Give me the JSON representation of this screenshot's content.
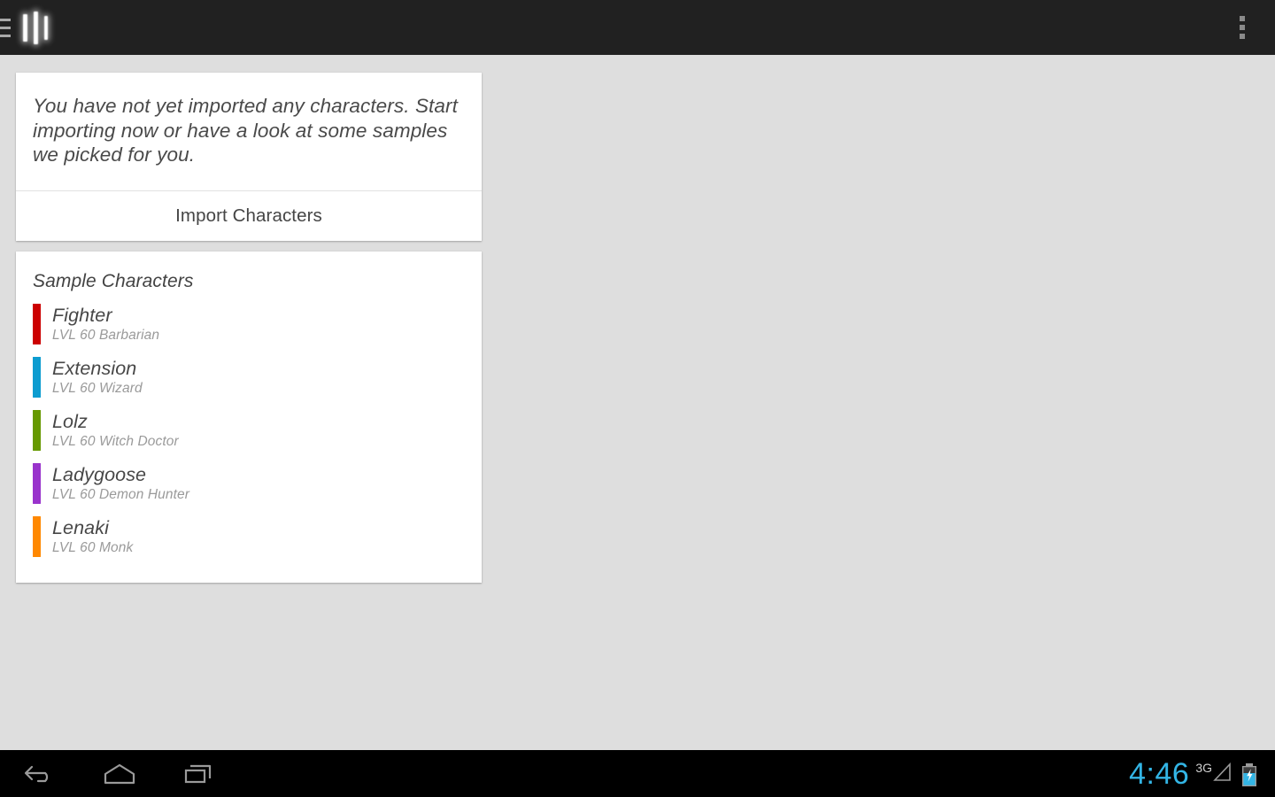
{
  "action_bar": {
    "drawer_icon": "hamburger-menu-icon",
    "logo_icon": "app-logo-three-bars",
    "overflow_icon": "overflow-menu-icon",
    "title": ""
  },
  "empty_state_card": {
    "message": "You have not yet imported any characters. Start importing now or have a look at some samples we picked for you.",
    "import_button_label": "Import Characters"
  },
  "samples_card": {
    "title": "Sample Characters",
    "characters": [
      {
        "name": "Fighter",
        "detail": "LVL 60 Barbarian",
        "color": "#cc0000"
      },
      {
        "name": "Extension",
        "detail": "LVL 60 Wizard",
        "color": "#0c9cd0"
      },
      {
        "name": "Lolz",
        "detail": "LVL 60 Witch Doctor",
        "color": "#669900"
      },
      {
        "name": "Ladygoose",
        "detail": "LVL 60 Demon Hunter",
        "color": "#9933cc"
      },
      {
        "name": "Lenaki",
        "detail": "LVL 60 Monk",
        "color": "#ff8800"
      }
    ]
  },
  "nav_bar": {
    "back_icon": "back-arrow-icon",
    "home_icon": "home-icon",
    "recents_icon": "recent-apps-icon"
  },
  "status_bar": {
    "time": "4:46",
    "network_type": "3G",
    "signal_icon": "signal-triangle-icon",
    "battery_icon": "battery-charging-icon",
    "accent_color": "#33b5e5"
  },
  "theme": {
    "background": "#dedede",
    "action_bar_bg": "#212121",
    "card_bg": "#ffffff",
    "nav_bar_bg": "#000000"
  }
}
